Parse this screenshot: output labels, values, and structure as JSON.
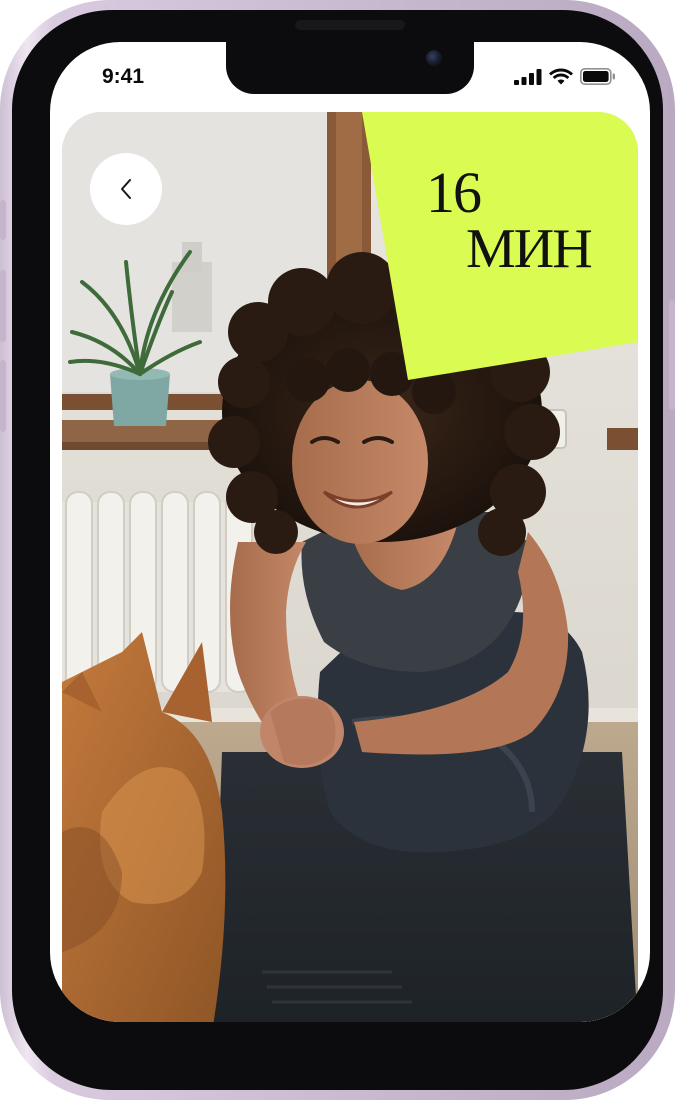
{
  "status_bar": {
    "time": "9:41"
  },
  "workout": {
    "duration_value": "16",
    "duration_unit": "МИН"
  },
  "icons": {
    "back": "chevron-left-icon",
    "signal": "cellular-signal-icon",
    "wifi": "wifi-icon",
    "battery": "battery-icon"
  },
  "colors": {
    "accent": "#D9FB52",
    "frame": "#D6C7DC",
    "background": "#FFFFFF"
  }
}
